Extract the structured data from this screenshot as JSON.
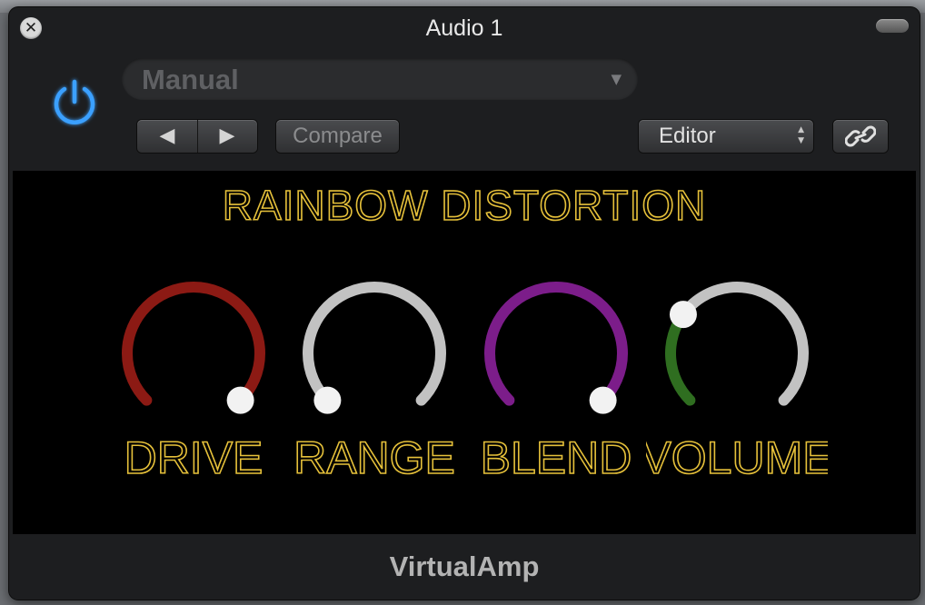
{
  "window": {
    "title": "Audio 1"
  },
  "header": {
    "power": {
      "icon": "power-icon",
      "state": "on",
      "color": "#3aa0ff"
    },
    "preset": {
      "value": "Manual"
    },
    "nav": {
      "prev_icon": "prev-arrow-icon",
      "next_icon": "next-arrow-icon"
    },
    "compare_label": "Compare",
    "view": {
      "value": "Editor"
    },
    "link_icon": "link-icon"
  },
  "plugin": {
    "title": "RAINBOW DISTORTION",
    "text_color": "#e5c03a",
    "knobs": [
      {
        "label": "DRIVE",
        "value": 1.0,
        "color": "#8c1a14"
      },
      {
        "label": "RANGE",
        "value": 0.0,
        "color": "#c8c8c8"
      },
      {
        "label": "BLEND",
        "value": 1.0,
        "color": "#7c1d8a"
      },
      {
        "label": "VOLUME",
        "value": 0.3,
        "color": "#2f6e20"
      }
    ],
    "track_color": "#c2c2c2"
  },
  "footer": {
    "plugin_name": "VirtualAmp"
  }
}
